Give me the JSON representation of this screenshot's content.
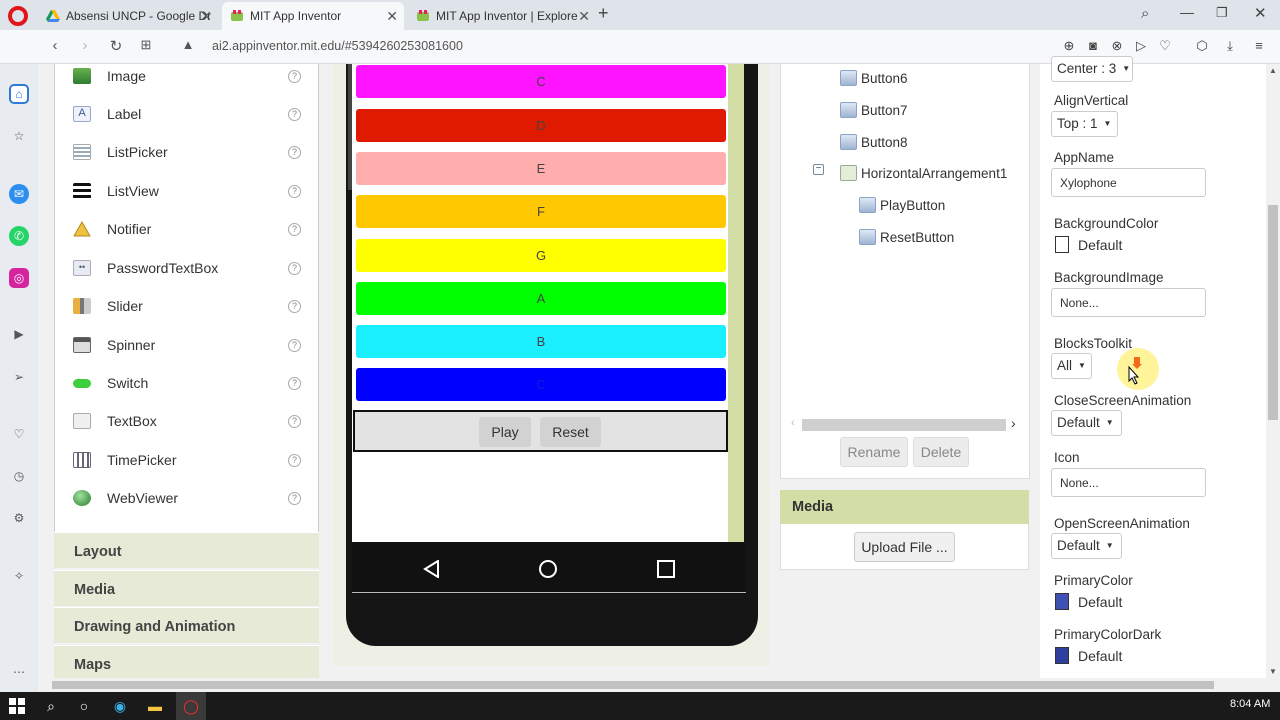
{
  "browser": {
    "tabs": [
      {
        "label": "Absensi UNCP - Google Dr",
        "active": false
      },
      {
        "label": "MIT App Inventor",
        "active": true
      },
      {
        "label": "MIT App Inventor | Explore",
        "active": false
      }
    ],
    "new_tab": "+",
    "url": "ai2.appinventor.mit.edu/#5394260253081600"
  },
  "palette": {
    "items": [
      {
        "label": "Image",
        "icon": "image-icon"
      },
      {
        "label": "Label",
        "icon": "label-icon"
      },
      {
        "label": "ListPicker",
        "icon": "listpicker-icon"
      },
      {
        "label": "ListView",
        "icon": "listview-icon"
      },
      {
        "label": "Notifier",
        "icon": "notifier-icon"
      },
      {
        "label": "PasswordTextBox",
        "icon": "password-icon"
      },
      {
        "label": "Slider",
        "icon": "slider-icon"
      },
      {
        "label": "Spinner",
        "icon": "spinner-icon"
      },
      {
        "label": "Switch",
        "icon": "switch-icon"
      },
      {
        "label": "TextBox",
        "icon": "textbox-icon"
      },
      {
        "label": "TimePicker",
        "icon": "timepicker-icon"
      },
      {
        "label": "WebViewer",
        "icon": "webviewer-icon"
      }
    ],
    "help": "?",
    "categories": [
      "Layout",
      "Media",
      "Drawing and Animation",
      "Maps"
    ]
  },
  "viewer": {
    "note_buttons": [
      {
        "label": "C",
        "color": "#ff14ff"
      },
      {
        "label": "D",
        "color": "#e01a00"
      },
      {
        "label": "E",
        "color": "#ffadad"
      },
      {
        "label": "F",
        "color": "#ffc800"
      },
      {
        "label": "G",
        "color": "#ffff00"
      },
      {
        "label": "A",
        "color": "#00ff00"
      },
      {
        "label": "B",
        "color": "#1aefff"
      },
      {
        "label": "C",
        "color": "#0000ff"
      }
    ],
    "play_label": "Play",
    "reset_label": "Reset"
  },
  "components": {
    "items": [
      {
        "label": "Button6",
        "indent": 1
      },
      {
        "label": "Button7",
        "indent": 1
      },
      {
        "label": "Button8",
        "indent": 1
      },
      {
        "label": "HorizontalArrangement1",
        "indent": 1,
        "collapsible": true
      },
      {
        "label": "PlayButton",
        "indent": 2
      },
      {
        "label": "ResetButton",
        "indent": 2
      }
    ],
    "rename_label": "Rename",
    "delete_label": "Delete"
  },
  "media": {
    "header": "Media",
    "upload_label": "Upload File ..."
  },
  "properties": {
    "align_horizontal_value": "Center : 3",
    "align_vertical_label": "AlignVertical",
    "align_vertical_value": "Top : 1",
    "app_name_label": "AppName",
    "app_name_value": "Xylophone",
    "background_color_label": "BackgroundColor",
    "background_color_value": "Default",
    "background_image_label": "BackgroundImage",
    "background_image_value": "None...",
    "blocks_toolkit_label": "BlocksToolkit",
    "blocks_toolkit_value": "All",
    "close_anim_label": "CloseScreenAnimation",
    "close_anim_value": "Default",
    "icon_label": "Icon",
    "icon_value": "None...",
    "open_anim_label": "OpenScreenAnimation",
    "open_anim_value": "Default",
    "primary_color_label": "PrimaryColor",
    "primary_color_value": "Default",
    "primary_color_swatch": "#3f51b5",
    "primary_color_dark_label": "PrimaryColorDark",
    "primary_color_dark_value": "Default",
    "primary_color_dark_swatch": "#303f9f"
  },
  "taskbar": {
    "clock": "8:04 AM"
  }
}
